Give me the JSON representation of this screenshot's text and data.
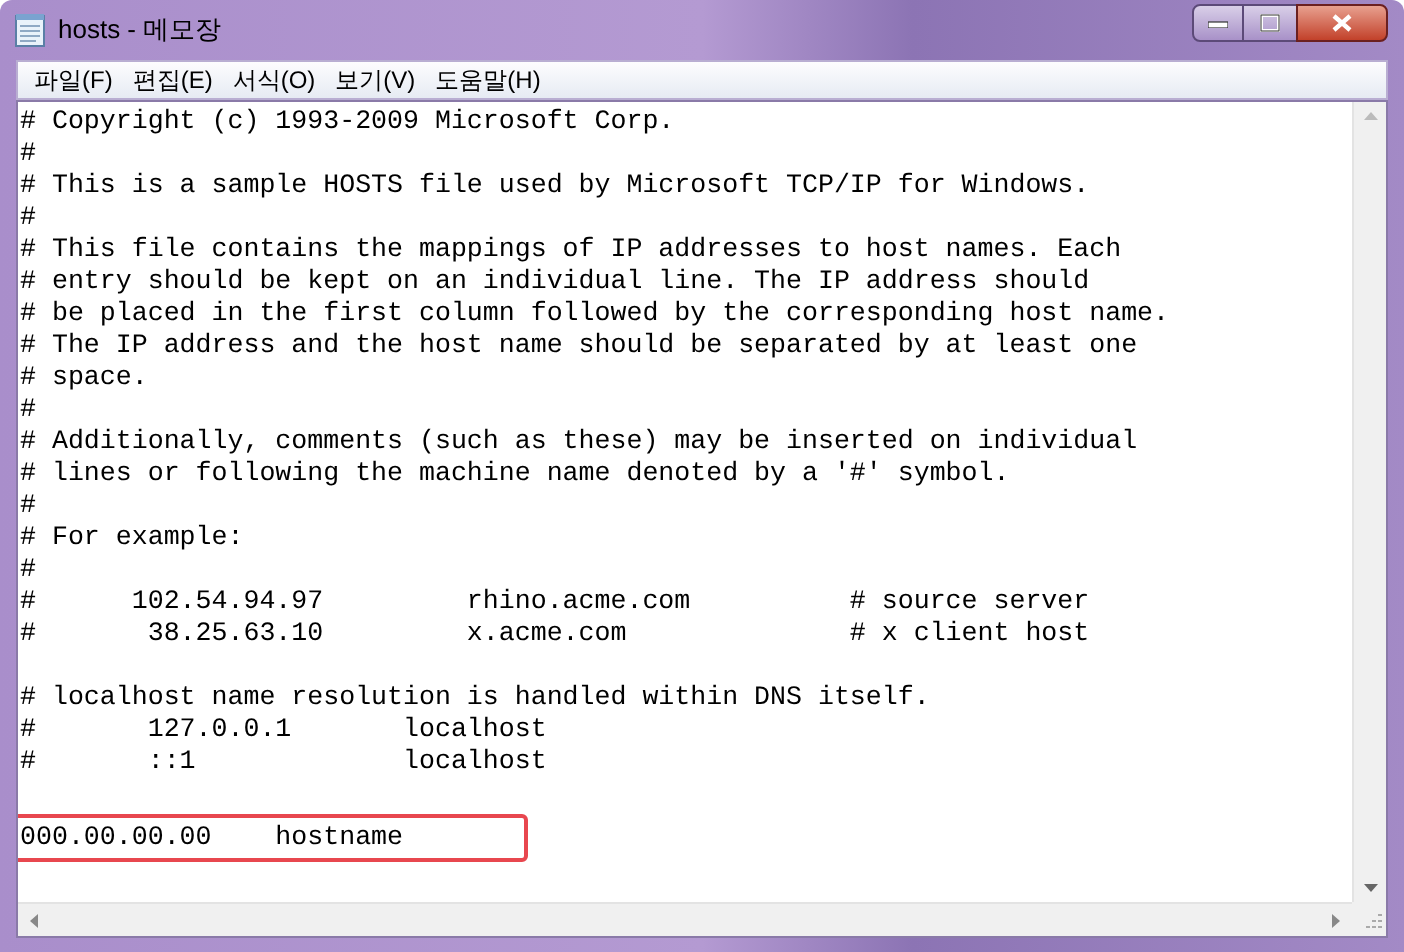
{
  "window": {
    "title": "hosts - 메모장"
  },
  "menu": [
    {
      "label": "파일(F)"
    },
    {
      "label": "편집(E)"
    },
    {
      "label": "서식(O)"
    },
    {
      "label": "보기(V)"
    },
    {
      "label": "도움말(H)"
    }
  ],
  "lines": [
    {
      "kind": "text",
      "text": "# Copyright (c) 1993-2009 Microsoft Corp."
    },
    {
      "kind": "text",
      "text": "#"
    },
    {
      "kind": "text",
      "text": "# This is a sample HOSTS file used by Microsoft TCP/IP for Windows."
    },
    {
      "kind": "text",
      "text": "#"
    },
    {
      "kind": "text",
      "text": "# This file contains the mappings of IP addresses to host names. Each"
    },
    {
      "kind": "text",
      "text": "# entry should be kept on an individual line. The IP address should"
    },
    {
      "kind": "text",
      "text": "# be placed in the first column followed by the corresponding host name."
    },
    {
      "kind": "text",
      "text": "# The IP address and the host name should be separated by at least one"
    },
    {
      "kind": "text",
      "text": "# space."
    },
    {
      "kind": "text",
      "text": "#"
    },
    {
      "kind": "text",
      "text": "# Additionally, comments (such as these) may be inserted on individual"
    },
    {
      "kind": "text",
      "text": "# lines or following the machine name denoted by a '#' symbol."
    },
    {
      "kind": "text",
      "text": "#"
    },
    {
      "kind": "text",
      "text": "# For example:"
    },
    {
      "kind": "text",
      "text": "#"
    },
    {
      "kind": "text",
      "text": "#      102.54.94.97         rhino.acme.com          # source server"
    },
    {
      "kind": "text",
      "text": "#       38.25.63.10         x.acme.com              # x client host"
    },
    {
      "kind": "blank"
    },
    {
      "kind": "text",
      "text": "# localhost name resolution is handled within DNS itself."
    },
    {
      "kind": "text",
      "text": "#       127.0.0.1       localhost"
    },
    {
      "kind": "text",
      "text": "#       ::1             localhost"
    },
    {
      "kind": "blank"
    },
    {
      "kind": "marked",
      "text": "000.00.00.00    hostname"
    }
  ]
}
